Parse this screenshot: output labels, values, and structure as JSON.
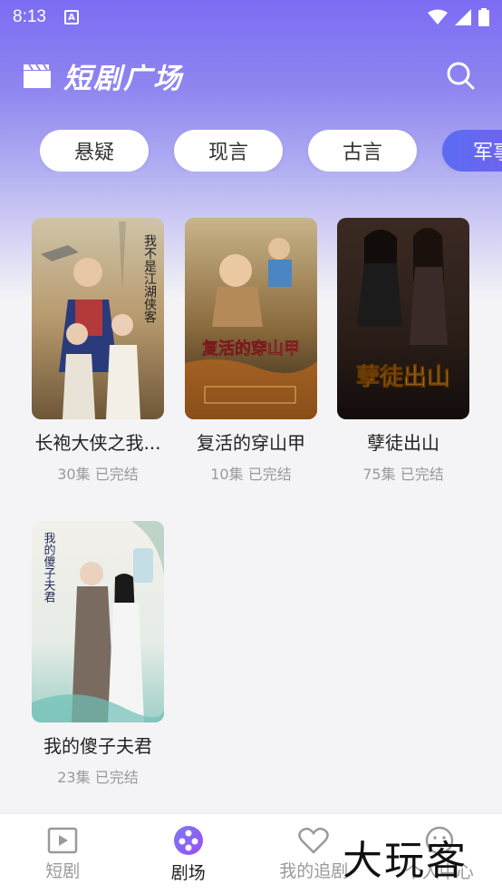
{
  "status": {
    "time": "8:13"
  },
  "header": {
    "title": "短剧广场"
  },
  "categories": [
    "悬疑",
    "现言",
    "古言",
    "军事"
  ],
  "dramas": [
    {
      "title": "长袍大侠之我...",
      "episodes": "30集",
      "state": "已完结"
    },
    {
      "title": "复活的穿山甲",
      "episodes": "10集",
      "state": "已完结"
    },
    {
      "title": "孽徒出山",
      "episodes": "75集",
      "state": "已完结"
    },
    {
      "title": "我的傻子夫君",
      "episodes": "23集",
      "state": "已完结"
    }
  ],
  "posters": [
    {
      "text": "我不是江湖侠客"
    },
    {
      "text": "复活的穿山甲"
    },
    {
      "text": "孽徒出山"
    },
    {
      "text": "我的傻子夫君"
    }
  ],
  "tabs": [
    {
      "label": "短剧",
      "icon": "play-square-icon"
    },
    {
      "label": "剧场",
      "icon": "theater-reel-icon"
    },
    {
      "label": "我的追剧",
      "icon": "heart-icon"
    },
    {
      "label": "个人中心",
      "icon": "smile-icon"
    }
  ],
  "watermark": "大玩客",
  "colors": {
    "accent": "#6a63f0",
    "chip_active": "#5b6cf2"
  }
}
